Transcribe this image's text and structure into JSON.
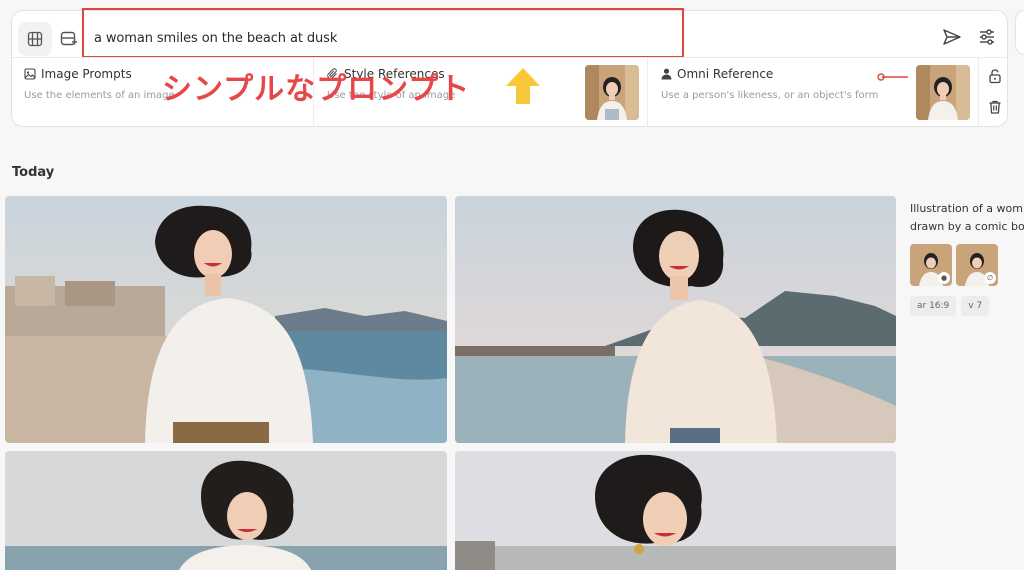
{
  "prompt": {
    "text": "a woman smiles on the beach at dusk"
  },
  "references": [
    {
      "title": "Image Prompts",
      "desc": "Use the elements of an image",
      "icon": "image-icon"
    },
    {
      "title": "Style References",
      "desc": "Use the style of an image",
      "icon": "paperclip-icon"
    },
    {
      "title": "Omni Reference",
      "desc": "Use a person's likeness, or an object's form",
      "icon": "person-icon"
    }
  ],
  "annotation": {
    "text": "シンプルなプロンプト",
    "color": "#e8474a",
    "arrow_color": "#f9c83a"
  },
  "feed": {
    "section_title": "Today",
    "prompt_text_line1": "Illustration of a wom",
    "prompt_text_line2": "drawn by a comic bo",
    "tags": [
      "ar 16:9",
      "v 7"
    ]
  }
}
